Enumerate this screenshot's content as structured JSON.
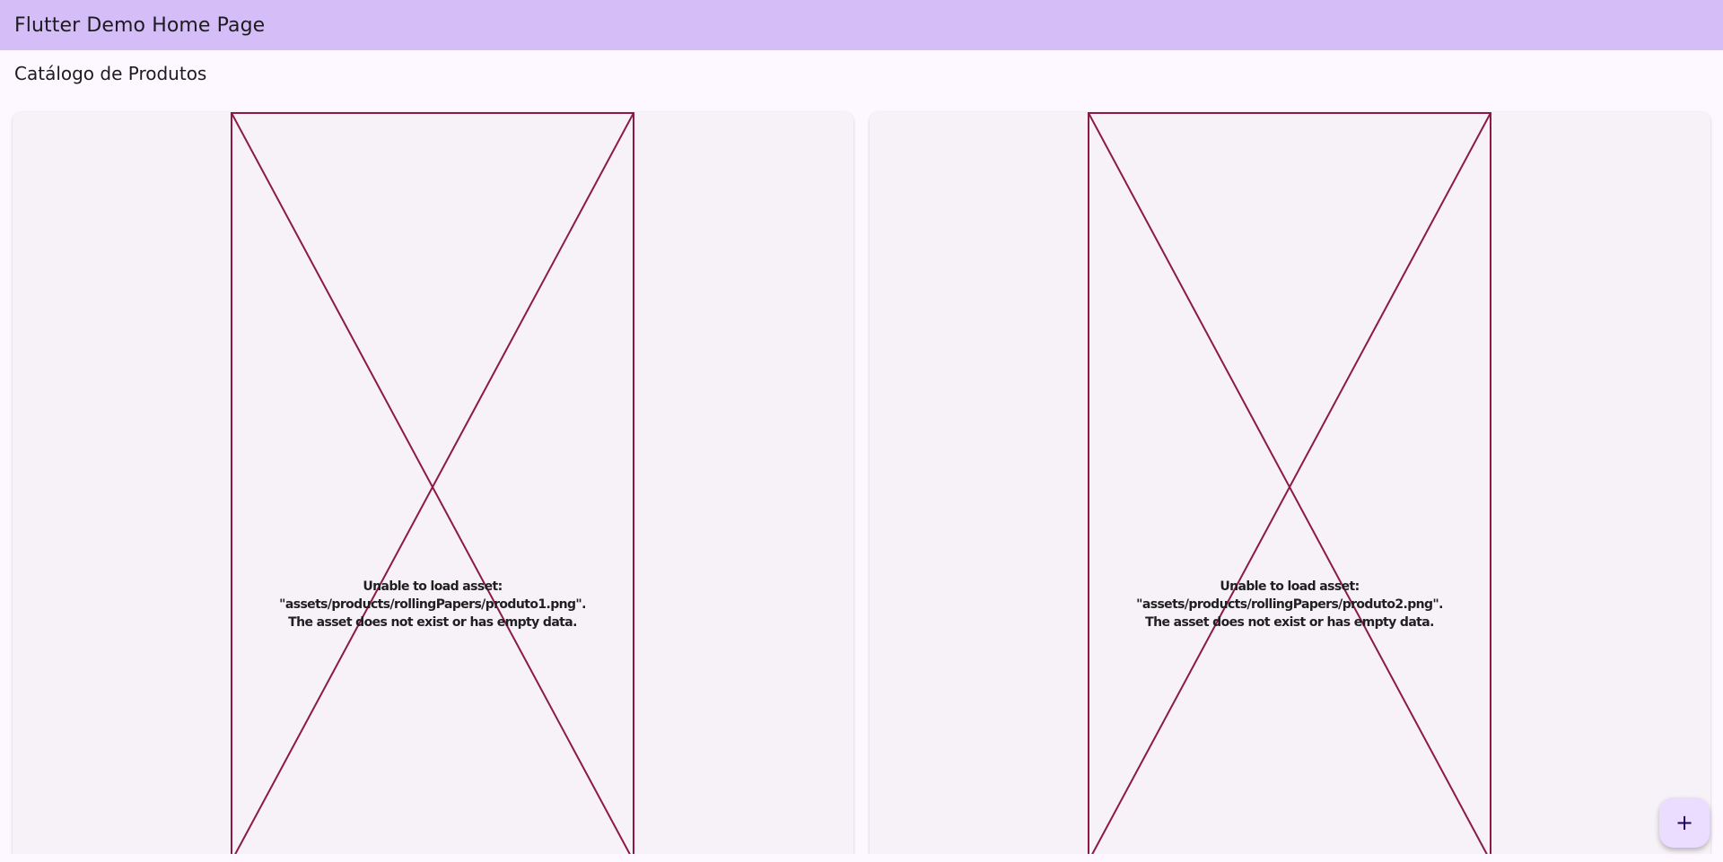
{
  "app_bar": {
    "title": "Flutter Demo Home Page"
  },
  "catalog": {
    "title": "Catálogo de Produtos",
    "products": [
      {
        "error_line1": "Unable to load asset: \"assets/products/rollingPapers/produto1.png\".",
        "error_line2": "The asset does not exist or has empty data."
      },
      {
        "error_line1": "Unable to load asset: \"assets/products/rollingPapers/produto2.png\".",
        "error_line2": "The asset does not exist or has empty data."
      }
    ]
  },
  "fab": {
    "icon": "plus-icon",
    "symbol": "+"
  },
  "colors": {
    "app_bar": "#d5bef8",
    "background": "#fdf7ff",
    "card": "#f7f1f8",
    "error_box": "#8b1a45",
    "fab": "#eaddff"
  }
}
